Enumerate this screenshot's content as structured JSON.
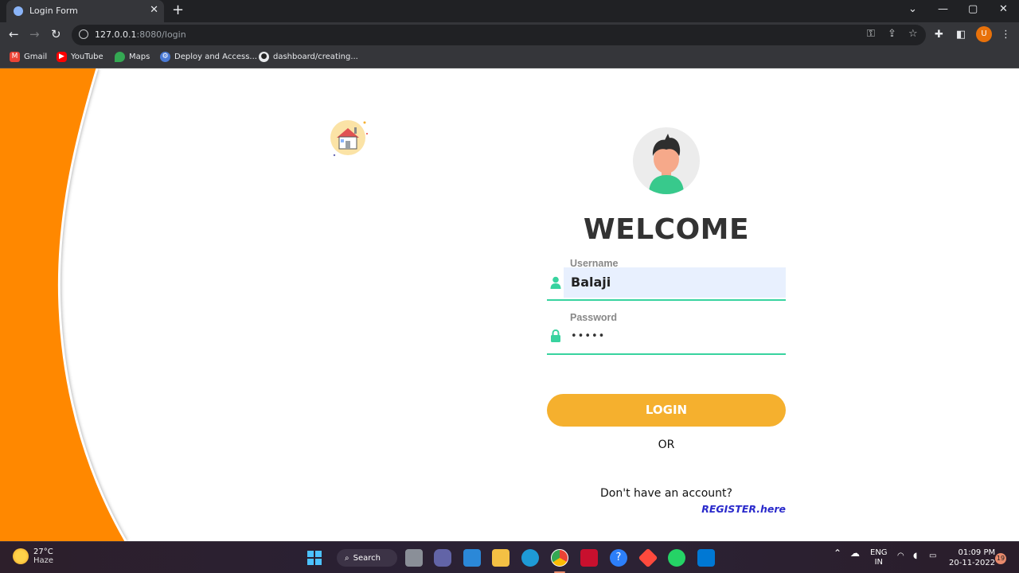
{
  "browser": {
    "tab_title": "Login Form",
    "new_tab_symbol": "+",
    "url_host": "127.0.0.1",
    "url_rest": ":8080/login",
    "bookmarks": [
      {
        "label": "Gmail",
        "icon": "gmail-icon"
      },
      {
        "label": "YouTube",
        "icon": "youtube-icon"
      },
      {
        "label": "Maps",
        "icon": "maps-icon"
      },
      {
        "label": "Deploy and Access...",
        "icon": "deploy-icon"
      },
      {
        "label": "dashboard/creating...",
        "icon": "github-icon"
      }
    ],
    "profile_initial": "U"
  },
  "page": {
    "heading": "WELCOME",
    "username": {
      "label": "Username",
      "value": "Balaji"
    },
    "password": {
      "label": "Password",
      "masked_value": "•••••"
    },
    "login_label": "LOGIN",
    "or_text": "OR",
    "no_account_text": "Don't have an account?",
    "register_link": "REGISTER.here",
    "colors": {
      "accent_orange": "#ff8800",
      "button_yellow": "#f5b02e",
      "field_green": "#38d39f",
      "link_blue": "#2a2acb"
    }
  },
  "taskbar": {
    "weather_temp": "27°C",
    "weather_desc": "Haze",
    "search_label": "Search",
    "lang_top": "ENG",
    "lang_bottom": "IN",
    "time": "01:09 PM",
    "date": "20-11-2022",
    "notification_count": "19"
  }
}
